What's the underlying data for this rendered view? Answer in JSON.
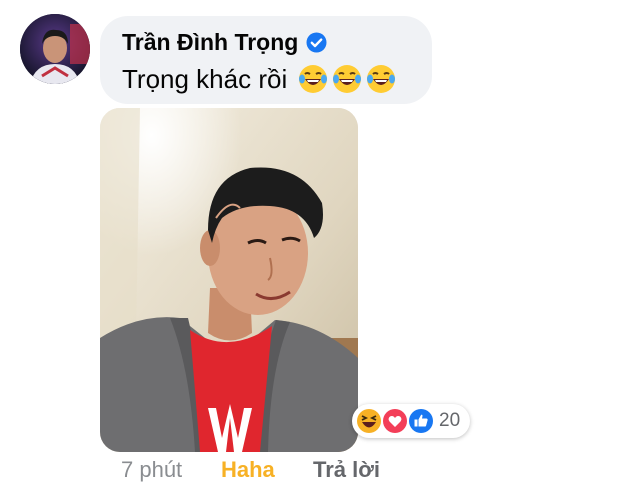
{
  "comment": {
    "author": "Trần Đình Trọng",
    "text": "Trọng khác rồi",
    "emojis": [
      "laughing-tears",
      "laughing-tears",
      "laughing-tears"
    ]
  },
  "reactions": {
    "icons": [
      "haha",
      "love",
      "like"
    ],
    "count": "20"
  },
  "actions": {
    "time": "7 phút",
    "reaction_label": "Haha",
    "reply": "Trả lời"
  },
  "colors": {
    "bubble": "#f0f2f5",
    "verified": "#1877f2",
    "haha": "#f7b125",
    "like": "#1877f2",
    "love": "#f33e58"
  }
}
